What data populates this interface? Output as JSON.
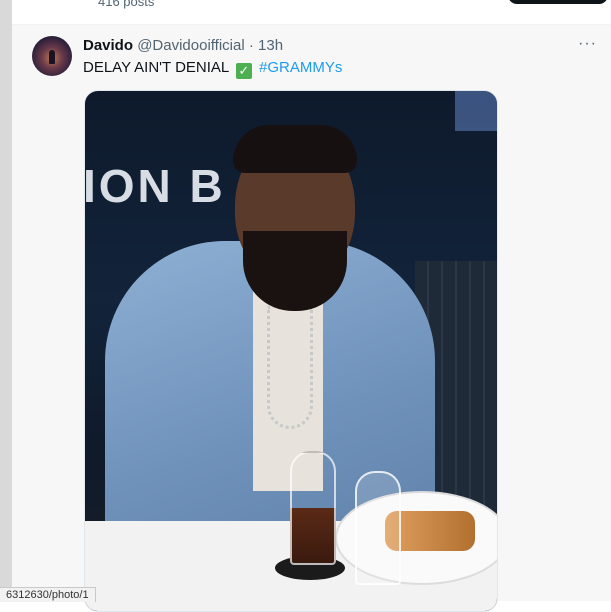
{
  "profile_header": {
    "posts_count_label": "416 posts"
  },
  "tweet": {
    "author_name": "Davido",
    "author_handle": "@Davidooifficial",
    "separator": "·",
    "timestamp": "13h",
    "text_main": "DELAY AIN'T DENIAL",
    "checkmark": "✓",
    "hashtag": "#GRAMMYs",
    "more_label": "···",
    "media": {
      "background_sign_text": "ION B"
    }
  },
  "status_bar": {
    "url_text": "6312630/photo/1"
  },
  "colors": {
    "link": "#1d9bf0",
    "muted": "#536471",
    "text": "#0f1419",
    "check_bg": "#4caf50"
  }
}
